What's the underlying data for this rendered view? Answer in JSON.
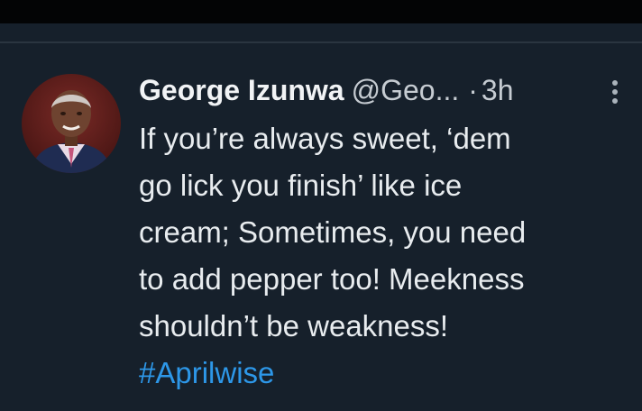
{
  "tweet": {
    "author_name": "George Izunwa",
    "handle": "@Geo...",
    "separator": "·",
    "time": "3h",
    "body_lines": [
      "If you’re always sweet, ‘dem",
      "go lick you finish’ like ice",
      "cream; Sometimes, you need",
      "to add pepper too! Meekness",
      "shouldn’t be weakness!"
    ],
    "hashtag": "#Aprilwise"
  },
  "icons": {
    "avatar": "profile-photo",
    "more": "more-vertical-icon"
  },
  "colors": {
    "background": "#16202b",
    "hashtag": "#2d97e8",
    "text": "#e8ecef",
    "secondary_text": "#c6ccd2"
  }
}
